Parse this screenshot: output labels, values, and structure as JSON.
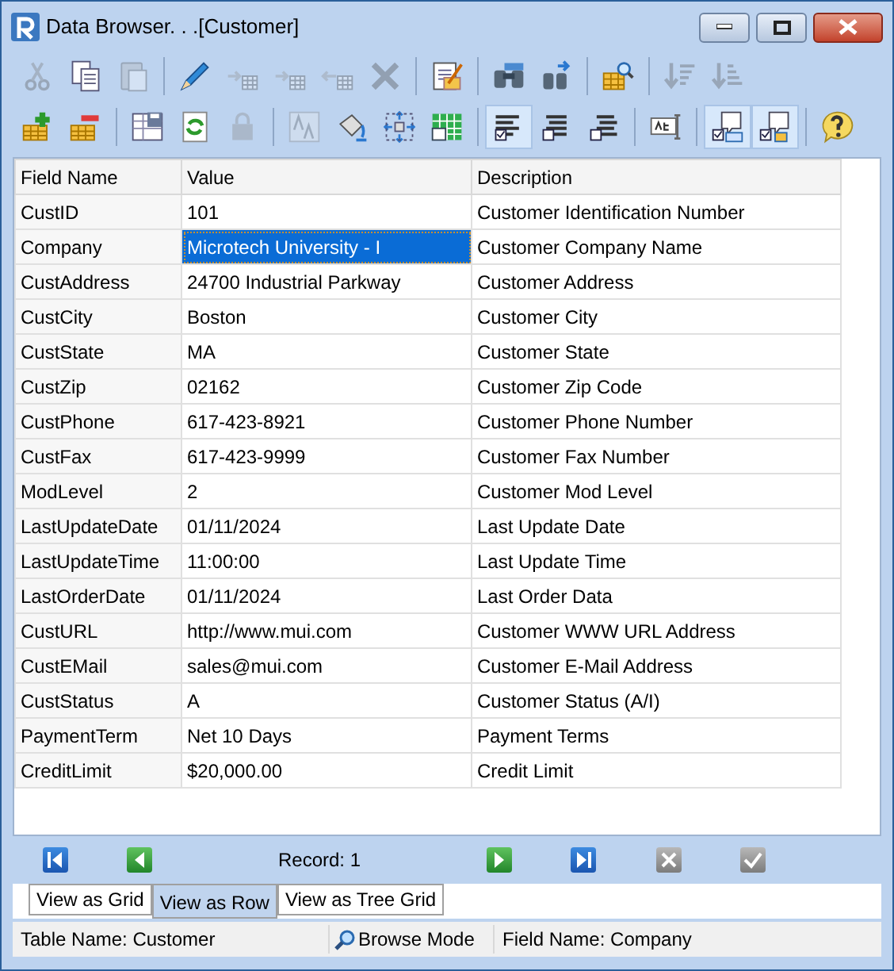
{
  "window": {
    "title": "Data Browser. . .[Customer]"
  },
  "toolbars": [
    {
      "groups": [
        [
          {
            "kind": "cut",
            "disabled": true,
            "pressed": false
          },
          {
            "kind": "copy",
            "disabled": false,
            "pressed": false
          },
          {
            "kind": "paste",
            "disabled": true,
            "pressed": false
          }
        ],
        [
          {
            "kind": "edit",
            "disabled": false,
            "pressed": false
          },
          {
            "kind": "insert-after",
            "disabled": true,
            "pressed": false
          },
          {
            "kind": "insert-before",
            "disabled": true,
            "pressed": false
          },
          {
            "kind": "insert-left",
            "disabled": true,
            "pressed": false
          },
          {
            "kind": "delete",
            "disabled": true,
            "pressed": false
          }
        ],
        [
          {
            "kind": "memo",
            "disabled": false,
            "pressed": false
          }
        ],
        [
          {
            "kind": "find",
            "disabled": false,
            "pressed": false
          },
          {
            "kind": "find-next",
            "disabled": false,
            "pressed": false
          }
        ],
        [
          {
            "kind": "filter",
            "disabled": false,
            "pressed": false
          }
        ],
        [
          {
            "kind": "sort-asc",
            "disabled": true,
            "pressed": false
          },
          {
            "kind": "sort-desc",
            "disabled": true,
            "pressed": false
          }
        ]
      ]
    },
    {
      "groups": [
        [
          {
            "kind": "add-row",
            "disabled": false,
            "pressed": false
          },
          {
            "kind": "remove-row",
            "disabled": false,
            "pressed": false
          }
        ],
        [
          {
            "kind": "save",
            "disabled": false,
            "pressed": false
          },
          {
            "kind": "refresh",
            "disabled": false,
            "pressed": false
          },
          {
            "kind": "lock",
            "disabled": true,
            "pressed": false
          }
        ],
        [
          {
            "kind": "font",
            "disabled": true,
            "pressed": false
          },
          {
            "kind": "fill",
            "disabled": false,
            "pressed": false
          },
          {
            "kind": "resize",
            "disabled": false,
            "pressed": false
          },
          {
            "kind": "grid",
            "disabled": false,
            "pressed": false
          }
        ],
        [
          {
            "kind": "align-left",
            "disabled": false,
            "pressed": true
          },
          {
            "kind": "align-center",
            "disabled": false,
            "pressed": false
          },
          {
            "kind": "align-right",
            "disabled": false,
            "pressed": false
          }
        ],
        [
          {
            "kind": "spell",
            "disabled": false,
            "pressed": false
          }
        ],
        [
          {
            "kind": "tip-grid",
            "disabled": false,
            "pressed": true
          },
          {
            "kind": "tip-form",
            "disabled": false,
            "pressed": true
          }
        ],
        [
          {
            "kind": "help",
            "disabled": false,
            "pressed": false
          }
        ]
      ]
    }
  ],
  "grid": {
    "columns": [
      "Field Name",
      "Value",
      "Description"
    ],
    "rows": [
      {
        "field": "CustID",
        "value": "101",
        "description": "Customer Identification Number",
        "selected": false
      },
      {
        "field": "Company",
        "value": "Microtech University - I",
        "description": "Customer Company Name",
        "selected": true
      },
      {
        "field": "CustAddress",
        "value": "24700 Industrial Parkway",
        "description": "Customer Address",
        "selected": false
      },
      {
        "field": "CustCity",
        "value": "Boston",
        "description": "Customer City",
        "selected": false
      },
      {
        "field": "CustState",
        "value": "MA",
        "description": "Customer State",
        "selected": false
      },
      {
        "field": "CustZip",
        "value": "02162",
        "description": "Customer Zip Code",
        "selected": false
      },
      {
        "field": "CustPhone",
        "value": "617-423-8921",
        "description": "Customer Phone Number",
        "selected": false
      },
      {
        "field": "CustFax",
        "value": "617-423-9999",
        "description": "Customer Fax Number",
        "selected": false
      },
      {
        "field": "ModLevel",
        "value": "2",
        "description": "Customer Mod Level",
        "selected": false
      },
      {
        "field": "LastUpdateDate",
        "value": "01/11/2024",
        "description": "Last Update Date",
        "selected": false
      },
      {
        "field": "LastUpdateTime",
        "value": "11:00:00",
        "description": "Last Update Time",
        "selected": false
      },
      {
        "field": "LastOrderDate",
        "value": "01/11/2024",
        "description": "Last Order Data",
        "selected": false
      },
      {
        "field": "CustURL",
        "value": "http://www.mui.com",
        "description": "Customer WWW URL Address",
        "selected": false
      },
      {
        "field": "CustEMail",
        "value": "sales@mui.com",
        "description": "Customer E-Mail Address",
        "selected": false
      },
      {
        "field": "CustStatus",
        "value": "A",
        "description": "Customer Status (A/I)",
        "selected": false
      },
      {
        "field": "PaymentTerm",
        "value": "Net 10 Days",
        "description": "Payment Terms",
        "selected": false
      },
      {
        "field": "CreditLimit",
        "value": "$20,000.00",
        "description": "Credit Limit",
        "selected": false
      }
    ]
  },
  "navigator": {
    "record": "Record: 1",
    "buttons": [
      {
        "kind": "first",
        "disabled": false
      },
      {
        "kind": "prior",
        "disabled": false
      },
      {
        "kind": "next",
        "disabled": false
      },
      {
        "kind": "last",
        "disabled": false
      },
      {
        "kind": "cancel",
        "disabled": true
      },
      {
        "kind": "post",
        "disabled": true
      }
    ]
  },
  "tabs": [
    {
      "label": "View as Grid",
      "selected": false
    },
    {
      "label": "View as Row",
      "selected": true
    },
    {
      "label": "View as Tree Grid",
      "selected": false
    }
  ],
  "status_bar": {
    "table": "Table Name: Customer",
    "mode": "Browse Mode",
    "field": "Field Name: Company"
  }
}
